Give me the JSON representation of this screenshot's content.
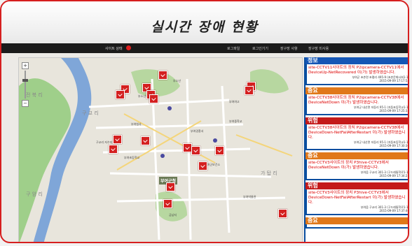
{
  "header": {
    "title": "실시간 장애 현황"
  },
  "toolbar": {
    "site_status_label": "사이트 상태",
    "menu": [
      "로그파일",
      "로그인기기",
      "장구장 사항",
      "장구장 미사용"
    ]
  },
  "map": {
    "big_places": [
      "전 북 리",
      "구 교 리",
      "가 탑 리",
      "구 암 리"
    ],
    "town_label": "부여군청",
    "places": [
      "부소산",
      "부여청사",
      "부여경찰서",
      "부여중학교",
      "부여초등학교",
      "부여군보건소",
      "구교리 저수지",
      "부여박물관",
      "궁남지",
      "부여여고",
      "부소산성"
    ]
  },
  "panel": {
    "events": [
      {
        "level": "정보",
        "color": "#1556b5",
        "message": "site-CCTV11사이트의 장치 P2ipcamera-CCTV11에서 DeviceUp-NetRecovered 이(가) 발생하였습니다.",
        "address": "부여군 초촌면 초평리 495-9 (초촌문화사회1-1)",
        "time": "2015-09-09 17:17:54"
      },
      {
        "level": "중요",
        "color": "#e0781a",
        "message": "site-CCTV38사이트의 장치 P2ipcamera-CCTV38에서 DeviceNetDown 이(가) 발생하였습니다.",
        "address": "부여군 내산면 저동리 95-1 (저동초등학교1-1)",
        "time": "2015-09-09 17:25:32"
      },
      {
        "level": "위험",
        "color": "#c41a1a",
        "message": "site-CCTV38사이트의 장치 P2ipcamera-CCTV38에서 DeviceDown-NetFailAfterRestart 이(가) 발생하였습니다.",
        "address": "부여군 내산면 저동리 95-1 (저동초등학교1-1)",
        "time": "2015-09-09 17:30:30"
      },
      {
        "level": "중요",
        "color": "#e0781a",
        "message": "site-CCTV3사이트의 장치 P3hive-CCTV3에서 DeviceNetDown 이(가) 발생하였습니다.",
        "address": "부여읍 구교리 301-3 (구드래통학로1-1)",
        "time": "2015-09-09 17:34:25"
      },
      {
        "level": "위험",
        "color": "#c41a1a",
        "message": "site-CCTV3사이트의 장치 P3hive-CCTV3에서 DeviceDown-NetFailAfterRestart 이(가) 발생하였습니다.",
        "address": "부여읍 구교리 301-3 (구드래통학로1-1)",
        "time": "2015-09-09 17:37:46"
      },
      {
        "level": "중요",
        "color": "#e0781a",
        "message": "",
        "address": "",
        "time": ""
      }
    ]
  }
}
